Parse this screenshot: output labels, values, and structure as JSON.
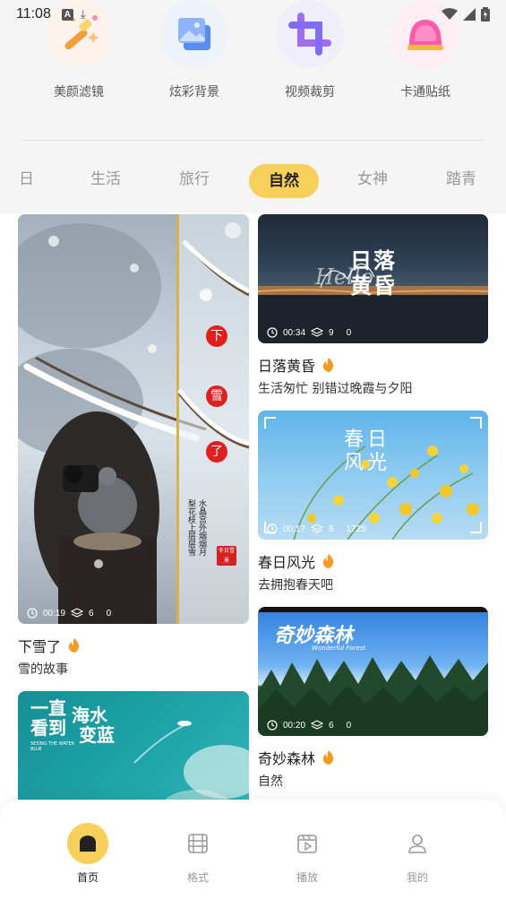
{
  "status_bar": {
    "time": "11:08",
    "notif_a": "A",
    "notif_dl": "⤓"
  },
  "tools": [
    {
      "label": "美颜滤镜",
      "icon": "magic-wand-icon"
    },
    {
      "label": "炫彩背景",
      "icon": "gallery-icon"
    },
    {
      "label": "视频裁剪",
      "icon": "crop-icon"
    },
    {
      "label": "卡通贴纸",
      "icon": "sticker-icon"
    }
  ],
  "tabs": [
    {
      "label": "日"
    },
    {
      "label": "生活"
    },
    {
      "label": "旅行"
    },
    {
      "label": "自然",
      "active": true
    },
    {
      "label": "女神"
    },
    {
      "label": "踏青"
    }
  ],
  "cards": {
    "snow": {
      "title": "下雪了",
      "subtitle": "雪的故事",
      "duration": "00:19",
      "layers": "6",
      "count": "0",
      "overlay_chars": [
        "下",
        "雪",
        "了"
      ],
      "poem": [
        "水晶宫外烟烟月",
        "梨花枝上层层雪"
      ],
      "seal": "冬日雪景"
    },
    "sunset": {
      "title": "日落黄昏",
      "subtitle": "生活匆忙 别错过晚霞与夕阳",
      "duration": "00:34",
      "layers": "9",
      "count": "0",
      "overlay_text": "日落黄昏",
      "script_text": "Hello"
    },
    "spring": {
      "title": "春日风光",
      "subtitle": "去拥抱春天吧",
      "duration": "00:17",
      "layers": "8",
      "count": "1725",
      "overlay_text": "春日风光"
    },
    "forest": {
      "title": "奇妙森林",
      "subtitle": "自然",
      "duration": "00:20",
      "layers": "6",
      "count": "0",
      "overlay_text": "奇妙森林",
      "overlay_sub": "Wonderful Forest"
    },
    "sea": {
      "overlay_line1": "一直",
      "overlay_line2": "看到",
      "overlay_right1": "海水",
      "overlay_right2": "变蓝",
      "overlay_small": "SEEING THE WATER BLUE"
    }
  },
  "bottom_nav": [
    {
      "label": "首页",
      "icon": "home-icon",
      "active": true
    },
    {
      "label": "格式",
      "icon": "film-icon"
    },
    {
      "label": "播放",
      "icon": "play-icon"
    },
    {
      "label": "我的",
      "icon": "user-icon"
    }
  ],
  "colors": {
    "accent": "#f7cf5b",
    "flame": "#f59a23"
  }
}
